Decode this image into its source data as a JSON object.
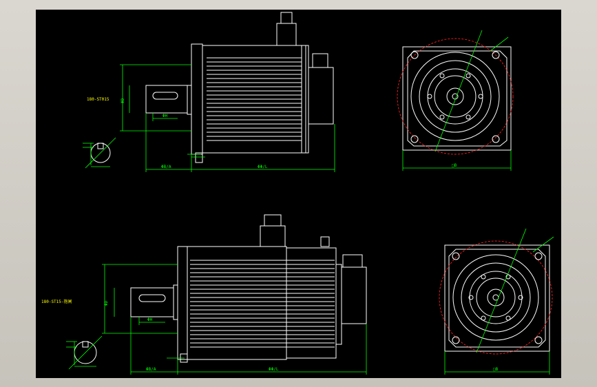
{
  "drawing": {
    "top_model_label": "180-ST015",
    "bottom_model_label": "180-ST15-抱闸"
  }
}
